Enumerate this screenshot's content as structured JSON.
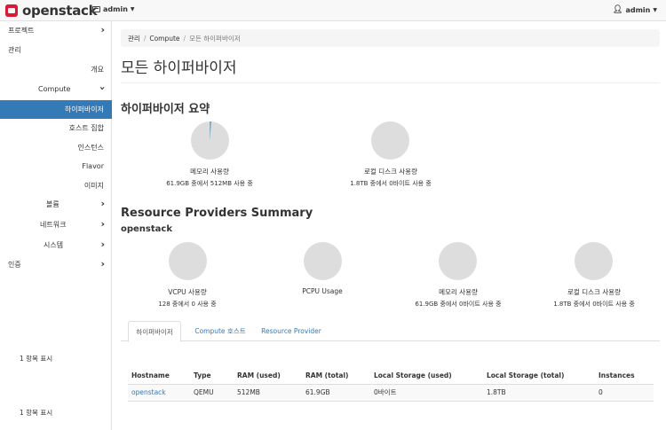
{
  "topbar": {
    "brand": "openstack",
    "project_menu": "admin",
    "user_menu": "admin"
  },
  "sidebar": {
    "items": [
      {
        "label": "프로젝트"
      },
      {
        "label": "관리"
      },
      {
        "label": "개요"
      },
      {
        "label": "Compute"
      },
      {
        "label": "하이퍼바이저"
      },
      {
        "label": "호스트 집합"
      },
      {
        "label": "인스턴스"
      },
      {
        "label": "Flavor"
      },
      {
        "label": "이미지"
      },
      {
        "label": "볼륨"
      },
      {
        "label": "네트워크"
      },
      {
        "label": "시스템"
      },
      {
        "label": "인증"
      }
    ]
  },
  "breadcrumb": {
    "items": [
      "관리",
      "Compute",
      "모든 하이퍼바이저"
    ]
  },
  "page_title": "모든 하이퍼바이저",
  "summary": {
    "heading": "하이퍼바이저 요약",
    "charts": [
      {
        "label": "메모리 사용량",
        "detail": "61.9GB 중에서 512MB 사용 중",
        "used_fraction": 0.008
      },
      {
        "label": "로컬 디스크 사용량",
        "detail": "1.8TB 중에서 0바이트 사용 중",
        "used_fraction": 0
      }
    ]
  },
  "resource_providers": {
    "heading": "Resource Providers Summary",
    "provider": "openstack",
    "charts": [
      {
        "label": "VCPU 사용량",
        "detail": "128 중에서 0 사용 중",
        "used_fraction": 0
      },
      {
        "label": "PCPU Usage",
        "detail": "",
        "used_fraction": 0
      },
      {
        "label": "메모리 사용량",
        "detail": "61.9GB 중에서 0바이트 사용 중",
        "used_fraction": 0
      },
      {
        "label": "로컬 디스크 사용량",
        "detail": "1.8TB 중에서 0바이트 사용 중",
        "used_fraction": 0
      }
    ]
  },
  "tabs": [
    {
      "label": "하이퍼바이저",
      "active": true
    },
    {
      "label": "Compute 호스트",
      "active": false
    },
    {
      "label": "Resource Provider",
      "active": false
    }
  ],
  "table": {
    "count_top": "1 항목 표시",
    "count_bottom": "1 항목 표시",
    "columns": [
      "Hostname",
      "Type",
      "RAM (used)",
      "RAM (total)",
      "Local Storage (used)",
      "Local Storage (total)",
      "Instances"
    ],
    "rows": [
      [
        "openstack",
        "QEMU",
        "512MB",
        "61.9GB",
        "0바이트",
        "1.8TB",
        "0"
      ]
    ]
  },
  "colors": {
    "accent": "#337ab7",
    "brand_red": "#da1a32",
    "pie_free": "#dddddd",
    "pie_used": "#1f77b4"
  }
}
